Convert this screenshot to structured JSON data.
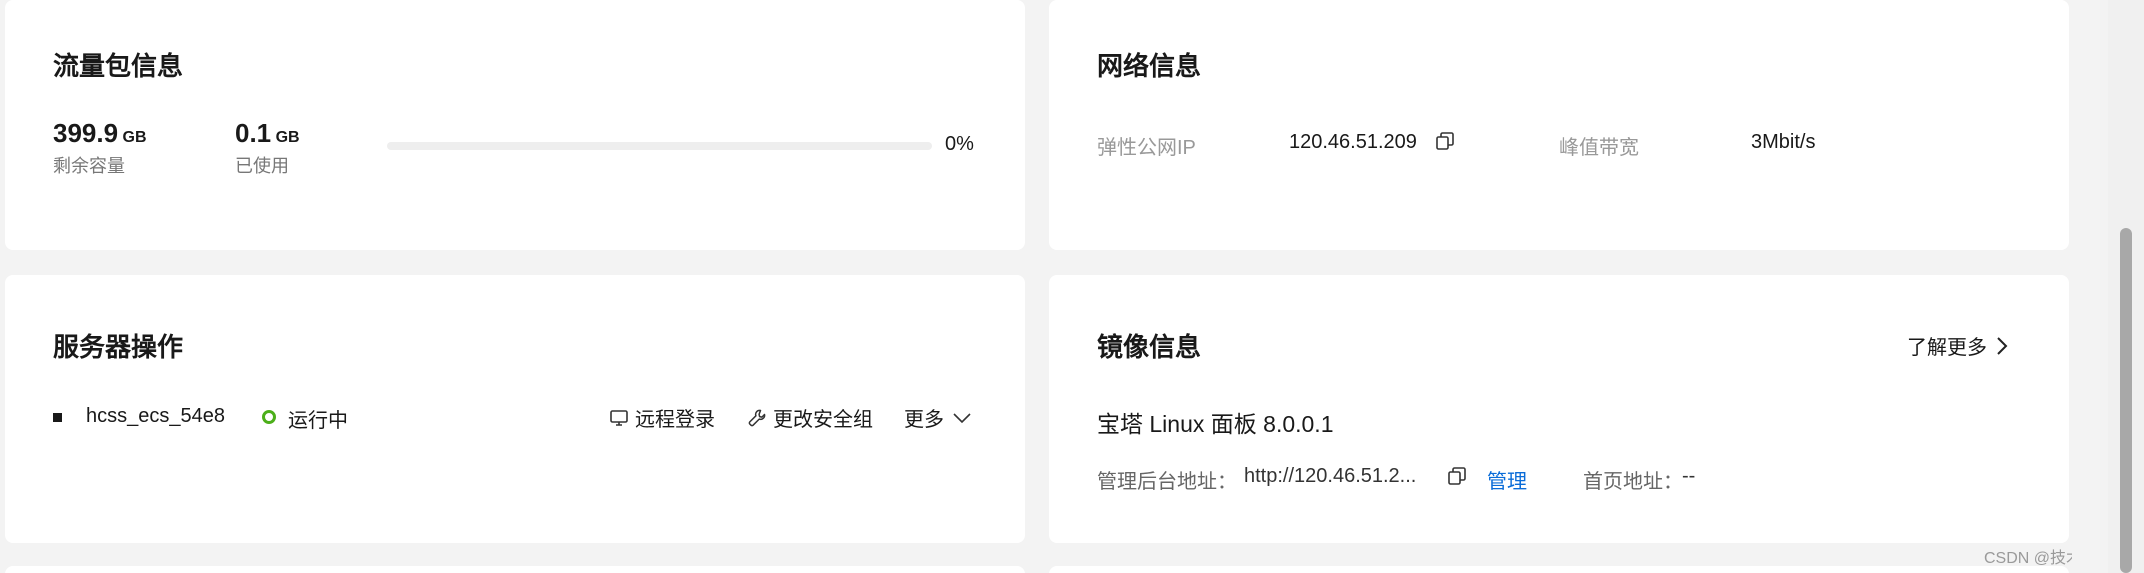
{
  "traffic": {
    "title": "流量包信息",
    "remaining_value": "399.9",
    "remaining_unit": "GB",
    "remaining_label": "剩余容量",
    "used_value": "0.1",
    "used_unit": "GB",
    "used_label": "已使用",
    "usage_percent": 0,
    "usage_text": "0%"
  },
  "network": {
    "title": "网络信息",
    "eip_label": "弹性公网IP",
    "eip_value": "120.46.51.209",
    "bandwidth_label": "峰值带宽",
    "bandwidth_value": "3Mbit/s"
  },
  "server_ops": {
    "title": "服务器操作",
    "server_name": "hcss_ecs_54e8",
    "status": "运行中",
    "status_color": "#4caf1a",
    "remote_login": "远程登录",
    "change_security_group": "更改安全组",
    "more": "更多"
  },
  "image": {
    "title": "镜像信息",
    "learn_more": "了解更多",
    "image_name": "宝塔 Linux 面板 8.0.0.1",
    "admin_label": "管理后台地址：",
    "admin_url": "http://120.46.51.2...",
    "manage": "管理",
    "home_label": "首页地址：",
    "home_value": "--"
  },
  "watermark": "CSDN @技术僧sxs"
}
